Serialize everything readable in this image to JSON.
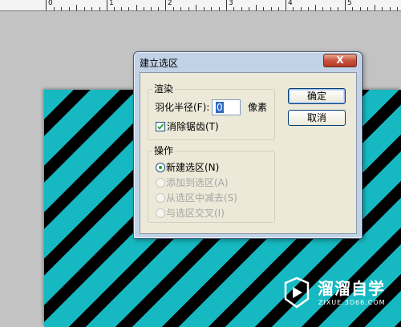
{
  "ruler": {
    "labels": [
      "0",
      "1",
      "2",
      "3",
      "4",
      "5"
    ]
  },
  "dialog": {
    "title": "建立选区",
    "close_label": "X",
    "render_group": {
      "legend": "渲染",
      "feather_label": "羽化半径(F):",
      "feather_value": "0",
      "feather_unit": "像素",
      "antialias_label": "消除锯齿(T)",
      "antialias_checked": true
    },
    "operation_group": {
      "legend": "操作",
      "options": [
        {
          "label": "新建选区(N)",
          "selected": true,
          "enabled": true
        },
        {
          "label": "添加到选区(A)",
          "selected": false,
          "enabled": false
        },
        {
          "label": "从选区中减去(S)",
          "selected": false,
          "enabled": false
        },
        {
          "label": "与选区交叉(I)",
          "selected": false,
          "enabled": false
        }
      ]
    },
    "ok_label": "确定",
    "cancel_label": "取消"
  },
  "watermark": {
    "title": "溜溜自学",
    "subtitle": "ZIXUE.3D66.COM"
  },
  "colors": {
    "canvas_cyan": "#16b9c1",
    "stripe": "#000000",
    "dialog_frame": "#c2d2e6"
  }
}
